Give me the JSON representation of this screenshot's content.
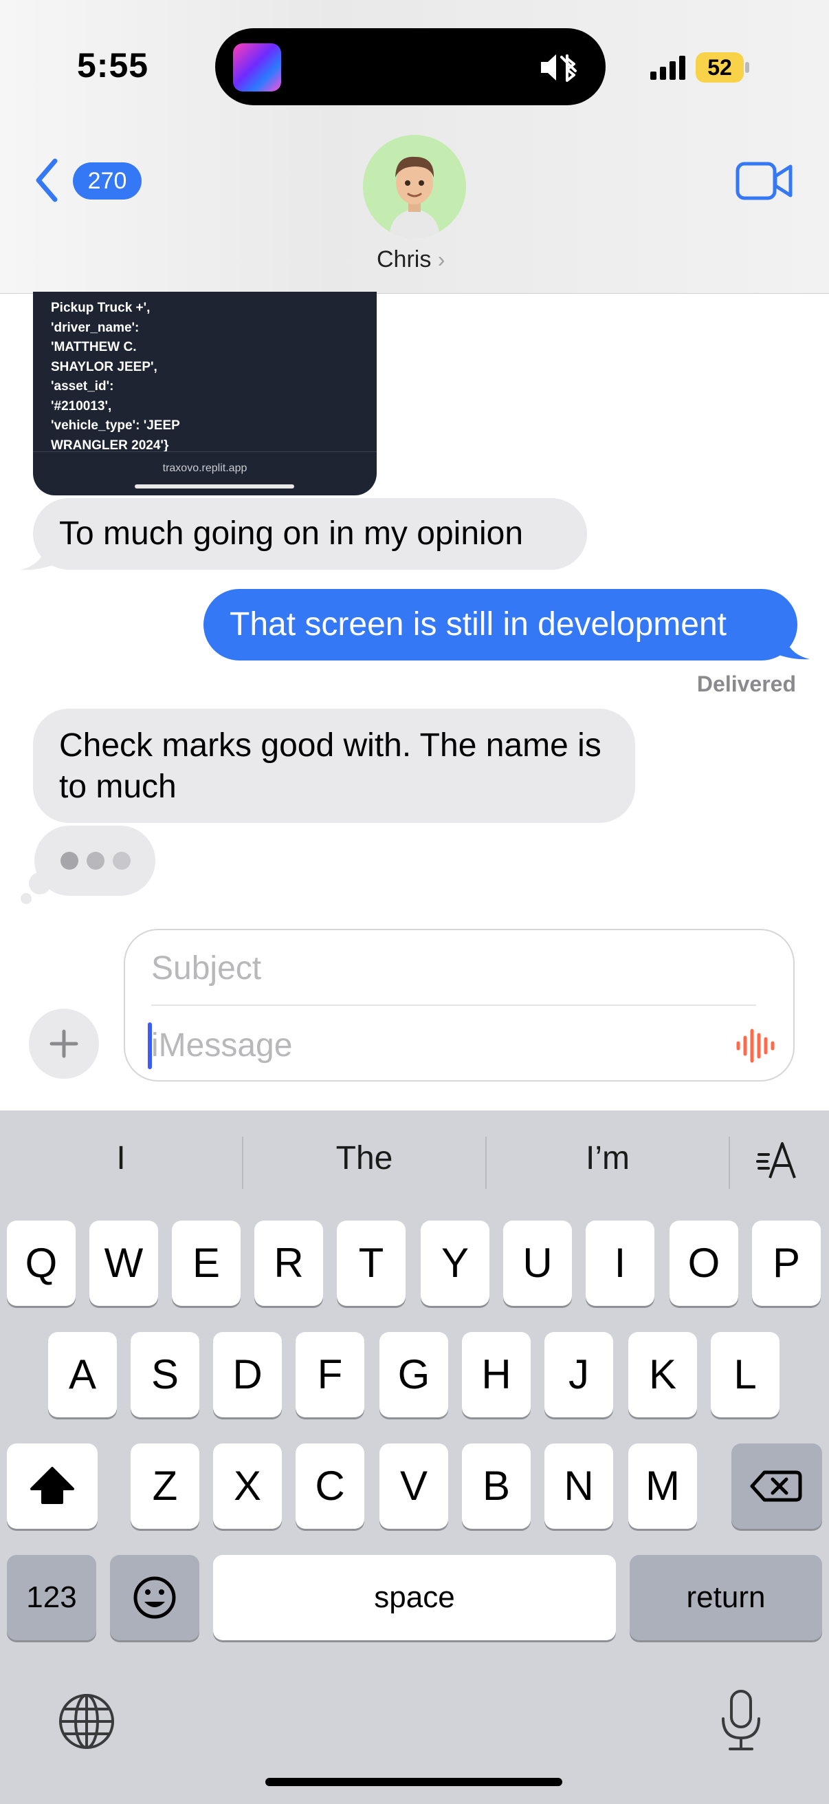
{
  "status_bar": {
    "time": "5:55",
    "battery": "52"
  },
  "header": {
    "back_count": "270",
    "contact_name": "Chris",
    "contact_chevron": "›"
  },
  "messages": {
    "attachment": {
      "code_text": "Pickup Truck +',\n'driver_name':\n'MATTHEW C.\nSHAYLOR JEEP',\n'asset_id':\n'#210013',\n'vehicle_type': 'JEEP\nWRANGLER 2024'}",
      "url": "traxovo.replit.app"
    },
    "msg1": "To much going on in my opinion",
    "msg2": "That screen is still in development",
    "delivered": "Delivered",
    "msg3": "Check marks good with. The name is to much"
  },
  "composer": {
    "subject_placeholder": "Subject",
    "message_placeholder": "iMessage"
  },
  "keyboard": {
    "suggestions": [
      "I",
      "The",
      "I’m"
    ],
    "row1": [
      "Q",
      "W",
      "E",
      "R",
      "T",
      "Y",
      "U",
      "I",
      "O",
      "P"
    ],
    "row2": [
      "A",
      "S",
      "D",
      "F",
      "G",
      "H",
      "J",
      "K",
      "L"
    ],
    "row3": [
      "Z",
      "X",
      "C",
      "V",
      "B",
      "N",
      "M"
    ],
    "numbers_label": "123",
    "space_label": "space",
    "return_label": "return"
  },
  "colors": {
    "accent": "#3478f6",
    "incoming_bubble": "#e9e9eb",
    "keyboard_bg": "#d1d3d9",
    "battery": "#f8d248",
    "audio": "#ff6b4a"
  },
  "icons": [
    "chevron-left-icon",
    "video-camera-icon",
    "mute-icon",
    "bluetooth-icon",
    "signal-icon",
    "battery-icon",
    "plus-icon",
    "audio-wave-icon",
    "shift-icon",
    "delete-icon",
    "emoji-icon",
    "globe-icon",
    "microphone-icon",
    "text-format-icon"
  ]
}
